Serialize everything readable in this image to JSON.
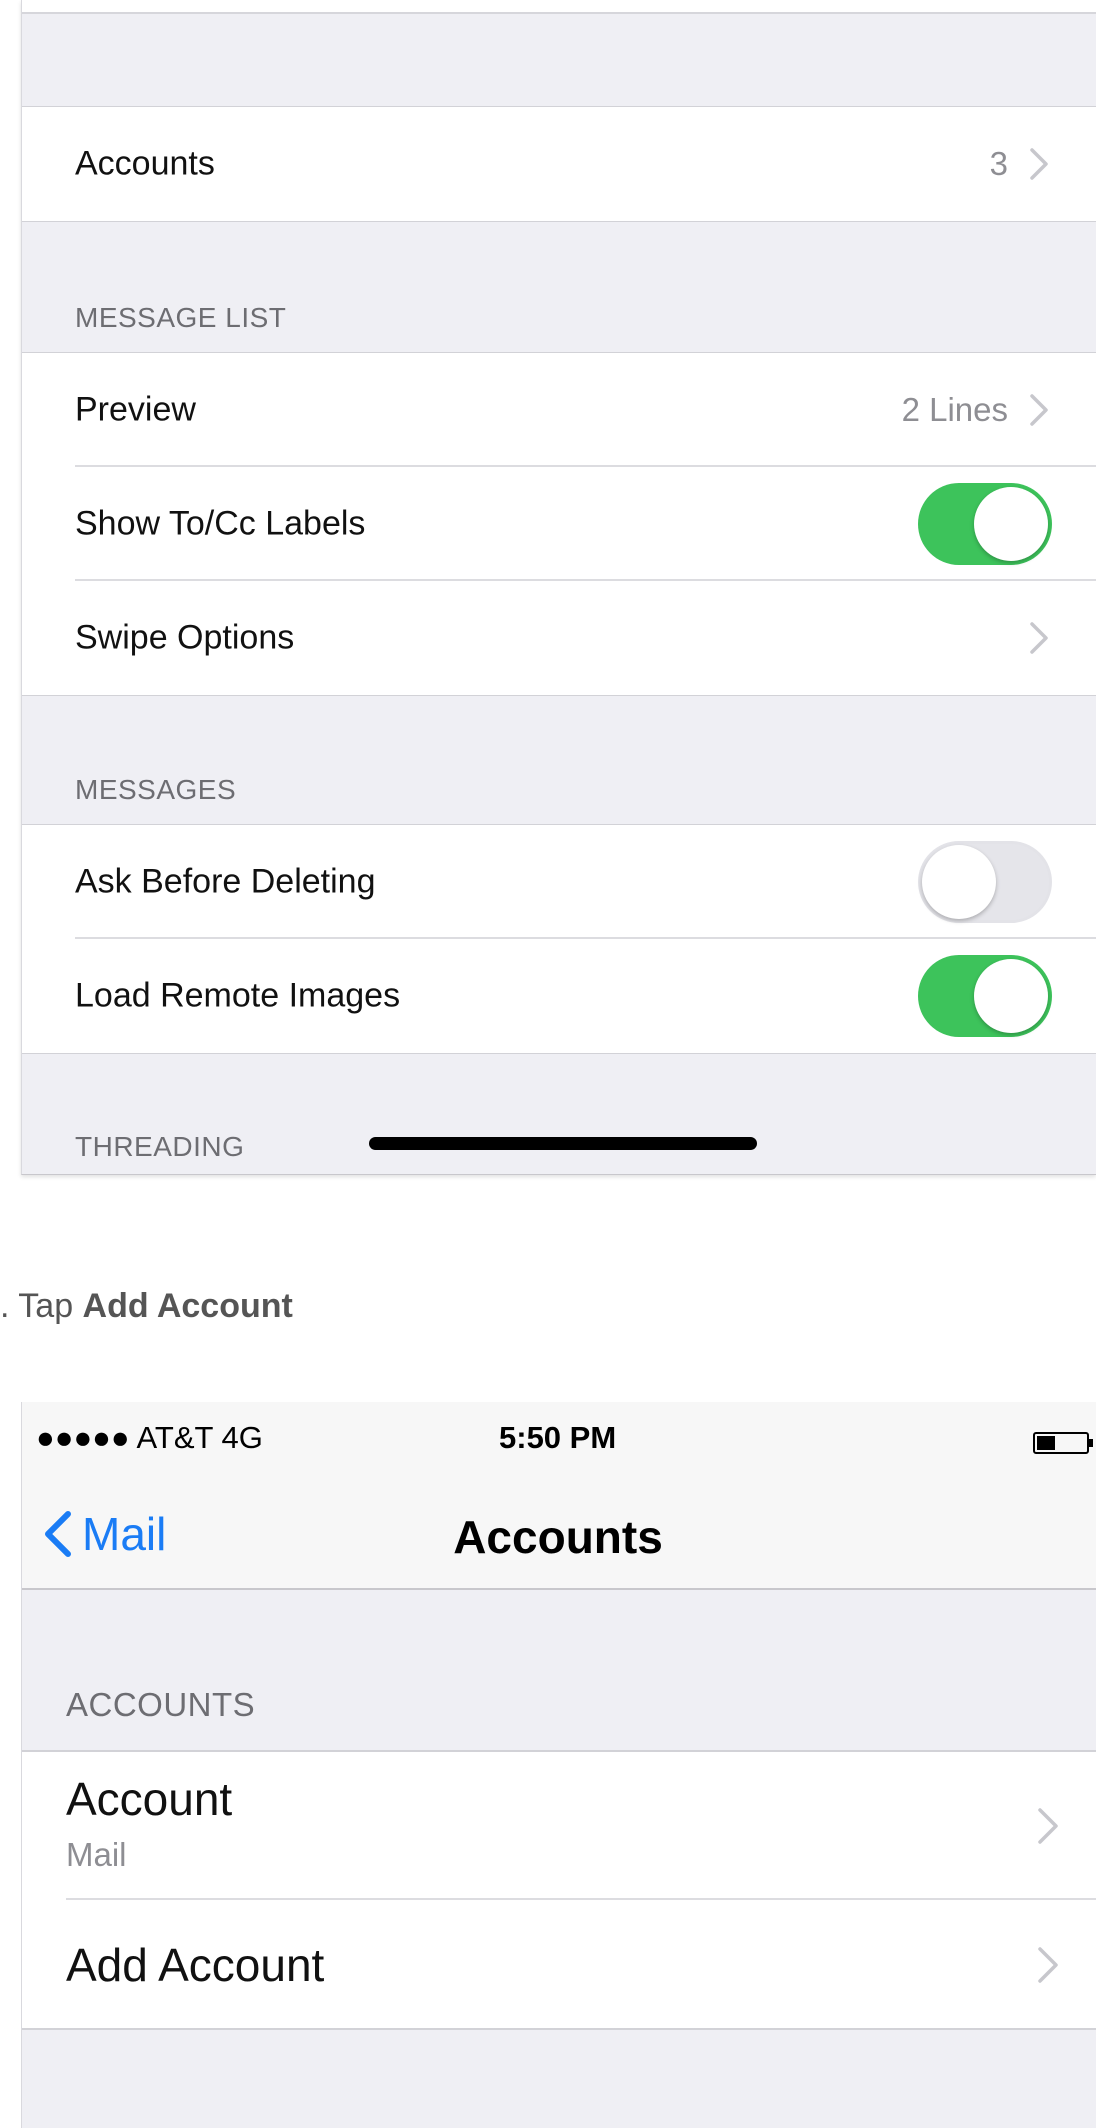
{
  "settings": {
    "accounts_row": {
      "label": "Accounts",
      "value": "3"
    },
    "message_list": {
      "header": "MESSAGE LIST",
      "preview": {
        "label": "Preview",
        "value": "2 Lines"
      },
      "show_to_cc": {
        "label": "Show To/Cc Labels",
        "on": true
      },
      "swipe_options": {
        "label": "Swipe Options"
      }
    },
    "messages": {
      "header": "MESSAGES",
      "ask_before_deleting": {
        "label": "Ask Before Deleting",
        "on": false
      },
      "load_remote_images": {
        "label": "Load Remote Images",
        "on": true
      }
    },
    "threading_header": "THREADING"
  },
  "caption": {
    "prefix": ". Tap ",
    "bold": "Add Account"
  },
  "accounts_screen": {
    "status": {
      "carrier": "●●●●● AT&T   4G",
      "time": "5:50 PM"
    },
    "nav": {
      "back_label": "Mail",
      "title": "Accounts"
    },
    "section_header": "ACCOUNTS",
    "rows": [
      {
        "title": "Account",
        "subtitle": "Mail"
      },
      {
        "title": "Add Account"
      }
    ]
  },
  "colors": {
    "toggle_on": "#3dc35b",
    "link_blue": "#1a7cf5",
    "group_bg": "#efeff4"
  },
  "icons": {
    "chevron": "chevron-right-icon",
    "back": "chevron-left-icon",
    "battery": "battery-icon"
  }
}
